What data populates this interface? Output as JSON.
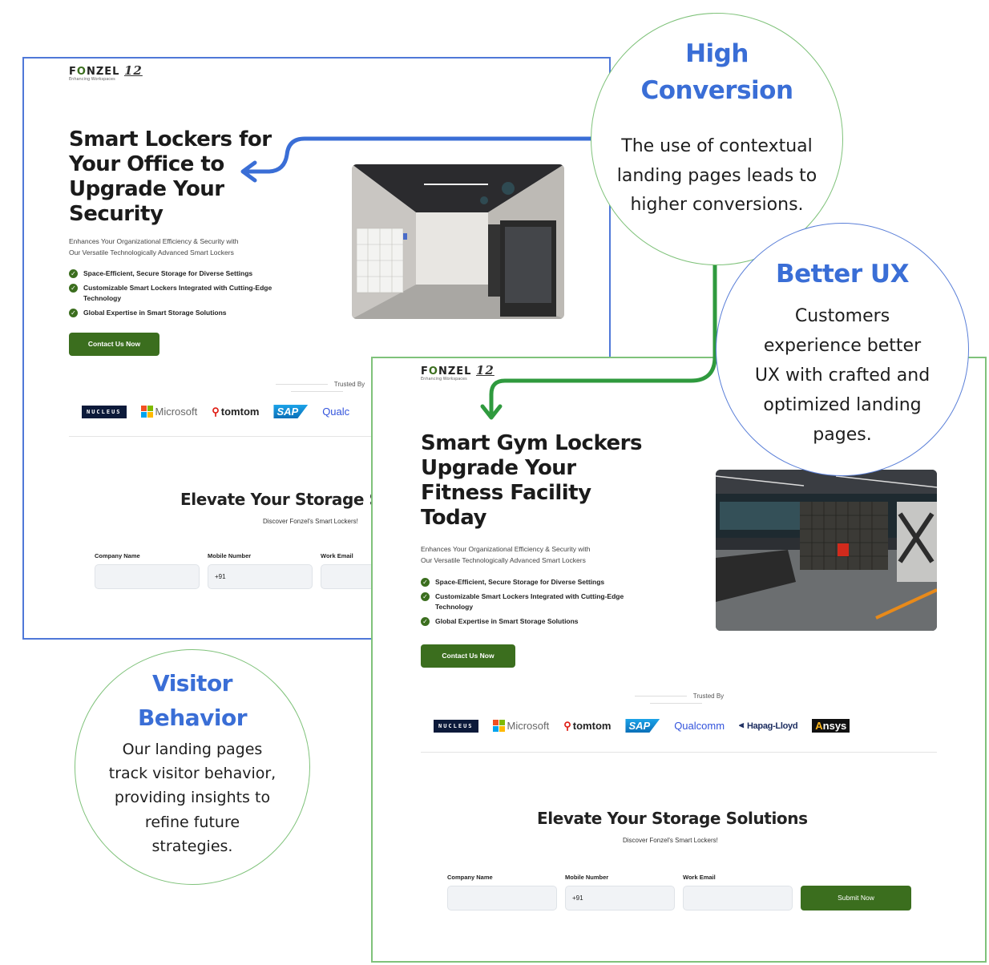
{
  "colors": {
    "brand_green": "#3b6e1e",
    "accent_blue": "#3a6ed6",
    "frame_blue": "#4f78d8",
    "frame_green": "#7fc27a"
  },
  "page1": {
    "logo": {
      "name_pre": "F",
      "name_o": "O",
      "name_post": "NZEL",
      "number": "12",
      "tagline": "Enhancing Workspaces"
    },
    "hero_title": [
      "Smart Lockers for",
      "Your Office to",
      "Upgrade Your",
      "Security"
    ],
    "subtitle": [
      "Enhances Your Organizational Efficiency & Security with",
      "Our Versatile Technologically Advanced Smart Lockers"
    ],
    "bullets": [
      "Space-Efficient, Secure Storage for Diverse Settings",
      "Customizable Smart Lockers Integrated with Cutting-Edge Technology",
      "Global Expertise in Smart Storage Solutions"
    ],
    "cta": "Contact Us Now",
    "trusted_by": "Trusted By",
    "form_title": "Elevate Your Storage Solutions",
    "form_subtitle": "Discover Fonzel's Smart Lockers!",
    "fields": {
      "company": "Company Name",
      "mobile": "Mobile Number",
      "email": "Work Email",
      "mobile_prefix": "+91"
    }
  },
  "page2": {
    "logo": {
      "name_pre": "F",
      "name_o": "O",
      "name_post": "NZEL",
      "number": "12",
      "tagline": "Enhancing Workspaces"
    },
    "hero_title": [
      "Smart Gym Lockers",
      "Upgrade Your",
      "Fitness Facility",
      "Today"
    ],
    "subtitle": [
      "Enhances Your Organizational Efficiency & Security with",
      "Our Versatile Technologically Advanced Smart Lockers"
    ],
    "bullets": [
      "Space-Efficient, Secure Storage for Diverse Settings",
      "Customizable Smart Lockers Integrated with Cutting-Edge Technology",
      "Global Expertise in Smart Storage Solutions"
    ],
    "cta": "Contact Us Now",
    "trusted_by": "Trusted By",
    "form_title": "Elevate Your Storage Solutions",
    "form_subtitle": "Discover Fonzel's Smart Lockers!",
    "fields": {
      "company": "Company Name",
      "mobile": "Mobile Number",
      "email": "Work Email",
      "mobile_prefix": "+91"
    },
    "submit": "Submit Now"
  },
  "trusted_logos": {
    "nucleus": "NUCLEUS",
    "microsoft": "Microsoft",
    "tomtom": "tomtom",
    "sap": "SAP",
    "qualcomm": "Qualcomm",
    "qualcomm_cut": "Qualc",
    "hapag": "Hapag-Lloyd",
    "ansys_a": "A",
    "ansys_rest": "nsys"
  },
  "callouts": {
    "high_conversion": {
      "title": [
        "High",
        "Conversion"
      ],
      "body": [
        "The use of contextual",
        "landing pages leads to",
        "higher conversions."
      ]
    },
    "better_ux": {
      "title": "Better UX",
      "body": [
        "Customers",
        "experience better",
        "UX with crafted and",
        "optimized landing",
        "pages."
      ]
    },
    "visitor_behavior": {
      "title": [
        "Visitor",
        "Behavior"
      ],
      "body": [
        "Our landing pages",
        "track visitor behavior,",
        "providing insights to",
        "refine future",
        "strategies."
      ]
    }
  }
}
